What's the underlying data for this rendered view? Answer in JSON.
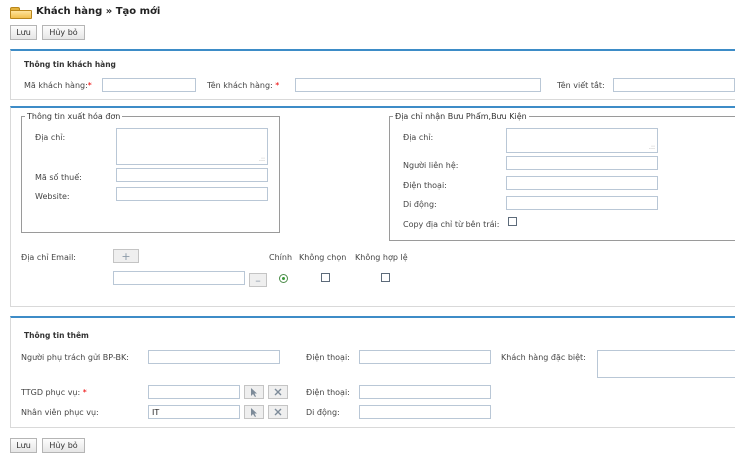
{
  "header": {
    "title": "Khách hàng » Tạo mới"
  },
  "toolbar": {
    "save_label": "Lưu",
    "cancel_label": "Hủy bỏ"
  },
  "customer_info": {
    "section_title": "Thông tin khách hàng",
    "code_label": "Mã khách hàng:",
    "name_label": "Tên khách hàng:",
    "short_name_label": "Tên viết tắt:",
    "required_mark": "*"
  },
  "invoice": {
    "legend": "Thông tin xuất hóa đơn",
    "address_label": "Địa chỉ:",
    "tax_code_label": "Mã số thuế:",
    "website_label": "Website:"
  },
  "postal": {
    "legend": "Địa chỉ nhận Bưu Phẩm,Bưu Kiện",
    "address_label": "Địa chỉ:",
    "contact_label": "Người liên hệ:",
    "phone_label": "Điện thoại:",
    "mobile_label": "Di động:",
    "copy_label": "Copy địa chỉ từ bên trái:"
  },
  "email": {
    "label": "Địa chỉ Email:",
    "col_primary": "Chính",
    "col_no_select": "Không chọn",
    "col_invalid": "Không hợp lệ",
    "add_symbol": "+",
    "remove_symbol": "–"
  },
  "additional": {
    "section_title": "Thông tin thêm",
    "sender_label": "Người phụ trách gửi BP-BK:",
    "phone_label": "Điện thoại:",
    "special_label": "Khách hàng đặc biệt:",
    "ttgd_label": "TTGD phục vụ:",
    "ttgd_phone_label": "Điện thoại:",
    "staff_label": "Nhân viên phục vụ:",
    "staff_value": "IT",
    "mobile_label": "Di động:"
  },
  "icons": {
    "select": "cursor-icon",
    "clear": "close-icon",
    "folder": "folder-icon"
  }
}
